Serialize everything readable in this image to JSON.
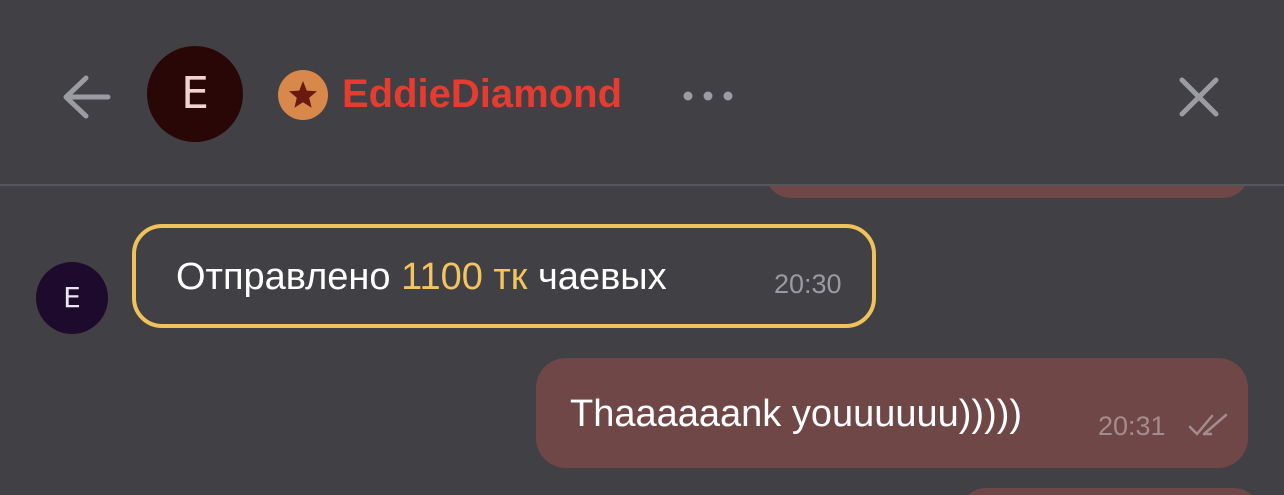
{
  "header": {
    "avatar_letter": "E",
    "username": "EddieDiamond",
    "icons": {
      "back": "arrow-left-icon",
      "badge": "star-icon",
      "more": "more-dots-icon",
      "close": "close-icon"
    }
  },
  "messages": [
    {
      "direction": "incoming",
      "avatar_letter": "E",
      "type": "tip",
      "text_before": "Отправлено",
      "amount": "1100 тк",
      "text_after": "чаевых",
      "time": "20:30"
    },
    {
      "direction": "outgoing",
      "type": "text",
      "text": "Thaaaaaank youuuuuu)))))",
      "time": "20:31",
      "status_icon": "double-check-icon"
    }
  ],
  "colors": {
    "background": "#404045",
    "username": "#e63b2f",
    "badge": "#d9884b",
    "tip_border": "#f0c25b",
    "tip_amount": "#f3c460",
    "outgoing_bubble": "#6f4747"
  }
}
